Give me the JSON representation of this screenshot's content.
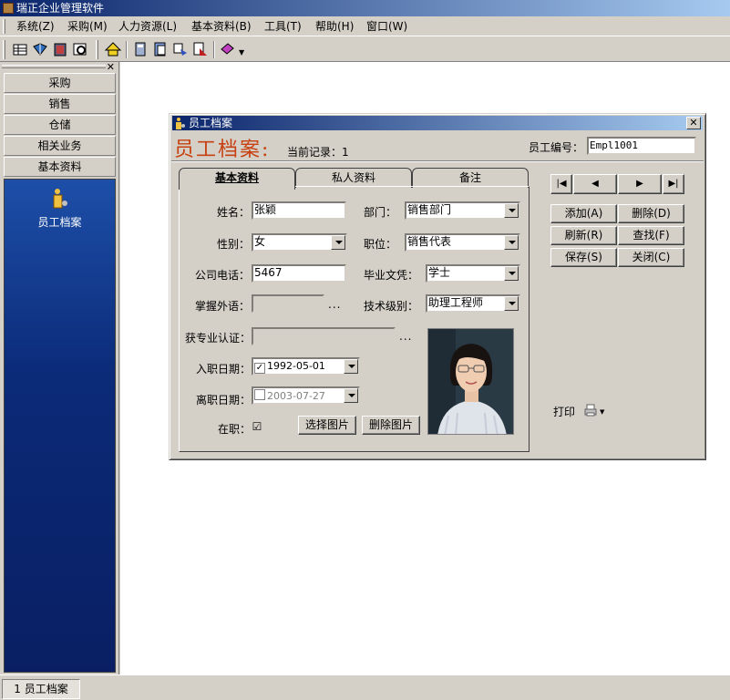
{
  "app": {
    "title": "瑞正企业管理软件"
  },
  "menu": [
    "系统(Z)",
    "采购(M)",
    "人力资源(L)",
    "基本资料(B)",
    "工具(T)",
    "帮助(H)",
    "窗口(W)"
  ],
  "nav": {
    "buttons": [
      "采购",
      "销售",
      "仓储",
      "相关业务",
      "基本资料"
    ],
    "panel_item": "员工档案"
  },
  "child": {
    "title": "员工档案",
    "big_title": "员工档案:",
    "current_record_label": "当前记录：1",
    "emp_no_label": "员工编号：",
    "emp_no_value": "Empl1001",
    "tabs": [
      "基本资料",
      "私人资料",
      "备注"
    ],
    "fields": {
      "name_label": "姓名：",
      "name_value": "张颖",
      "dept_label": "部门：",
      "dept_value": "销售部门",
      "gender_label": "性别：",
      "gender_value": "女",
      "position_label": "职位：",
      "position_value": "销售代表",
      "phone_label": "公司电话：",
      "phone_value": "5467",
      "degree_label": "毕业文凭：",
      "degree_value": "学士",
      "lang_label": "掌握外语：",
      "lang_value": "",
      "tech_label": "技术级别：",
      "tech_value": "助理工程师",
      "cert_label": "获专业认证：",
      "cert_value": "",
      "hire_label": "入职日期：",
      "hire_value": "1992-05-01",
      "leave_label": "离职日期：",
      "leave_value": "2003-07-27",
      "active_label": "在职：",
      "ellipsis": "..."
    },
    "photo_buttons": {
      "choose": "选择图片",
      "delete": "删除图片"
    },
    "nav_buttons": [
      "|◀",
      "◀",
      "▶",
      "▶|"
    ],
    "action_buttons": [
      "添加(A)",
      "删除(D)",
      "刷新(R)",
      "查找(F)",
      "保存(S)",
      "关闭(C)"
    ],
    "print_label": "打印"
  },
  "statusbar": {
    "tab": "1 员工档案"
  }
}
